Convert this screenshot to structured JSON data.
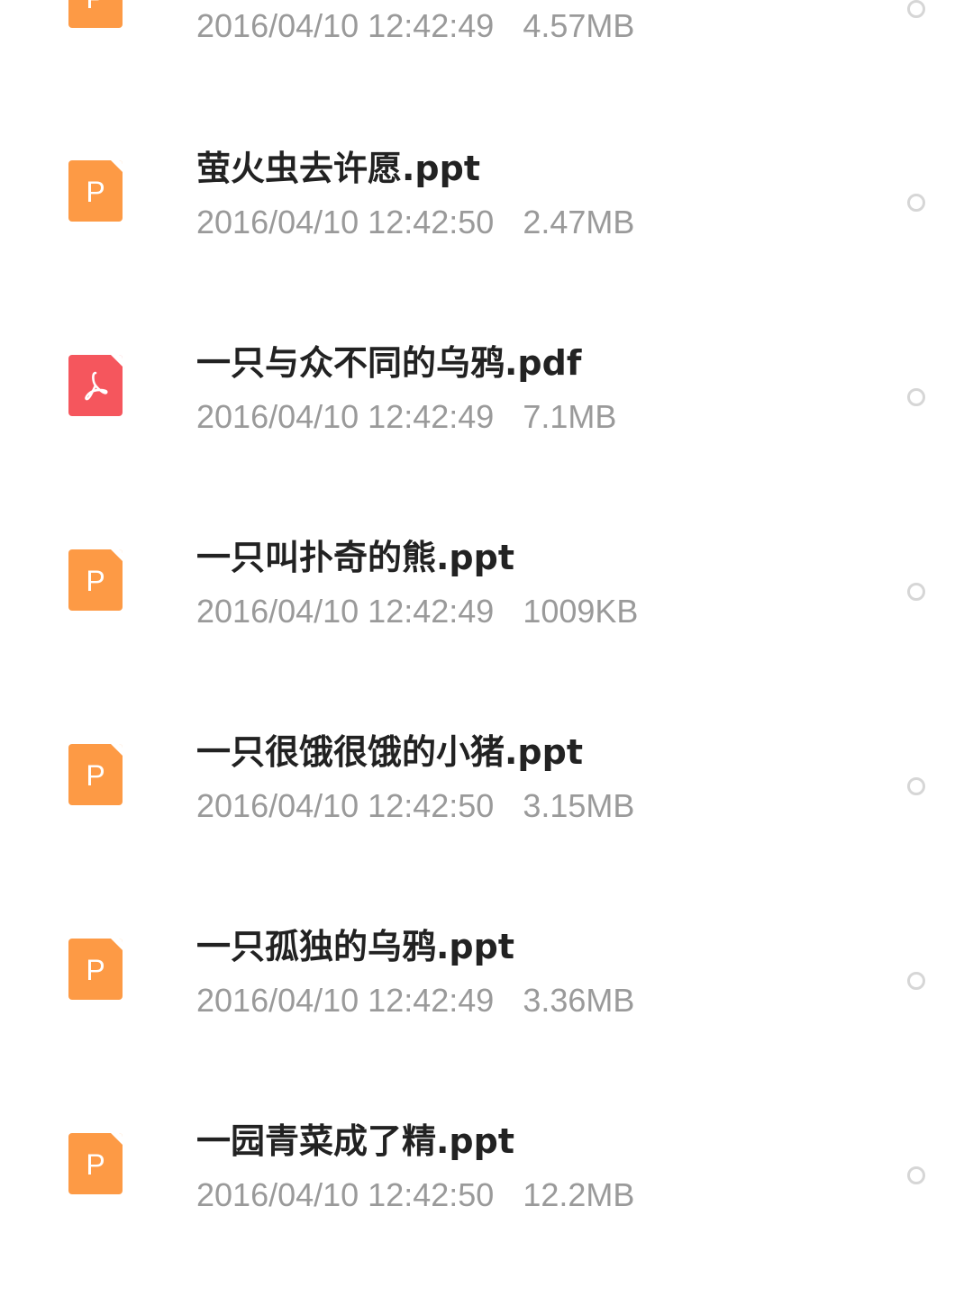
{
  "files": [
    {
      "name": "",
      "date": "2016/04/10 12:42:49",
      "size": "4.57MB",
      "type": "ppt",
      "icon": "ppt-file-icon",
      "icon_letter": "P"
    },
    {
      "name": "萤火虫去许愿.ppt",
      "date": "2016/04/10 12:42:50",
      "size": "2.47MB",
      "type": "ppt",
      "icon": "ppt-file-icon",
      "icon_letter": "P"
    },
    {
      "name": "一只与众不同的乌鸦.pdf",
      "date": "2016/04/10 12:42:49",
      "size": "7.1MB",
      "type": "pdf",
      "icon": "pdf-file-icon",
      "icon_letter": ""
    },
    {
      "name": "一只叫扑奇的熊.ppt",
      "date": "2016/04/10 12:42:49",
      "size": "1009KB",
      "type": "ppt",
      "icon": "ppt-file-icon",
      "icon_letter": "P"
    },
    {
      "name": "一只很饿很饿的小猪.ppt",
      "date": "2016/04/10 12:42:50",
      "size": "3.15MB",
      "type": "ppt",
      "icon": "ppt-file-icon",
      "icon_letter": "P"
    },
    {
      "name": "一只孤独的乌鸦.ppt",
      "date": "2016/04/10 12:42:49",
      "size": "3.36MB",
      "type": "ppt",
      "icon": "ppt-file-icon",
      "icon_letter": "P"
    },
    {
      "name": "一园青菜成了精.ppt",
      "date": "2016/04/10 12:42:50",
      "size": "12.2MB",
      "type": "ppt",
      "icon": "ppt-file-icon",
      "icon_letter": "P"
    }
  ],
  "colors": {
    "ppt_icon": "#fd9a45",
    "pdf_icon": "#f5565d",
    "name_text": "#222222",
    "meta_text": "#9a9a9a",
    "radio_border": "#d6d6d6"
  }
}
